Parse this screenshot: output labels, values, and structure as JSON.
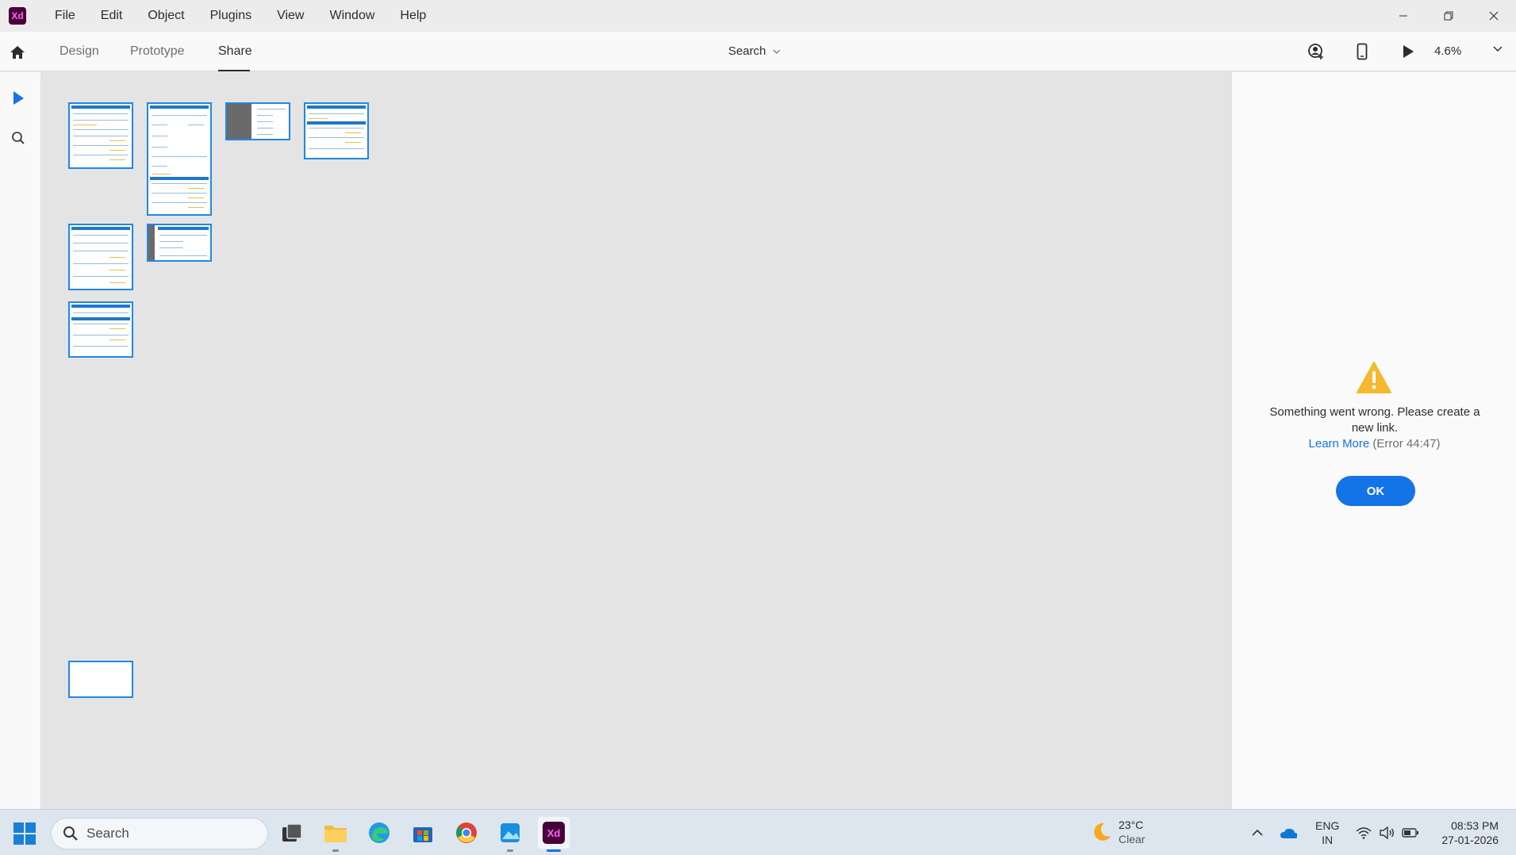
{
  "app": {
    "logo_text": "Xd",
    "menu": [
      "File",
      "Edit",
      "Object",
      "Plugins",
      "View",
      "Window",
      "Help"
    ]
  },
  "toolbar": {
    "tabs": [
      "Design",
      "Prototype",
      "Share"
    ],
    "active_tab": "Share",
    "search_label": "Search",
    "zoom": "4.6%"
  },
  "canvas": {
    "artboard_count": 8
  },
  "share_panel": {
    "error_message": "Something went wrong. Please create a new link.",
    "learn_more": "Learn More",
    "error_code": "(Error 44:47)",
    "ok_label": "OK"
  },
  "taskbar": {
    "search_placeholder": "Search",
    "weather_temp": "23°C",
    "weather_condition": "Clear",
    "lang_primary": "ENG",
    "lang_region": "IN",
    "time": "08:53 PM",
    "date": "27-01-2026"
  },
  "colors": {
    "accent": "#1473e6",
    "artboard_border": "#1e88e5",
    "warning": "#f5b82e",
    "xd_brand": "#470137"
  }
}
